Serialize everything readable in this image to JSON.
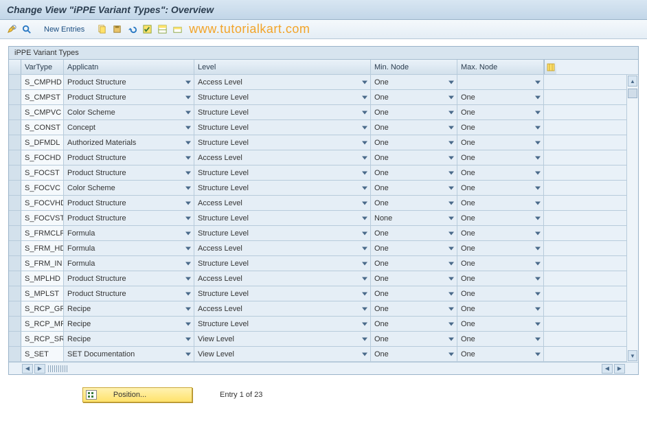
{
  "title": "Change View \"iPPE Variant Types\": Overview",
  "toolbar": {
    "new_entries": "New Entries"
  },
  "watermark": "www.tutorialkart.com",
  "panel": {
    "title": "iPPE Variant Types"
  },
  "columns": {
    "vartype": "VarType",
    "application": "Applicatn",
    "level": "Level",
    "min_node": "Min. Node",
    "max_node": "Max. Node"
  },
  "rows": [
    {
      "vartype": "S_CMPHD",
      "application": "Product Structure",
      "level": "Access Level",
      "min": "One",
      "max": ""
    },
    {
      "vartype": "S_CMPST",
      "application": "Product Structure",
      "level": "Structure Level",
      "min": "One",
      "max": "One"
    },
    {
      "vartype": "S_CMPVC",
      "application": "Color Scheme",
      "level": "Structure Level",
      "min": "One",
      "max": "One"
    },
    {
      "vartype": "S_CONST",
      "application": "Concept",
      "level": "Structure Level",
      "min": "One",
      "max": "One"
    },
    {
      "vartype": "S_DFMDL",
      "application": "Authorized Materials",
      "level": "Structure Level",
      "min": "One",
      "max": "One"
    },
    {
      "vartype": "S_FOCHD",
      "application": "Product Structure",
      "level": "Access Level",
      "min": "One",
      "max": "One"
    },
    {
      "vartype": "S_FOCST",
      "application": "Product Structure",
      "level": "Structure Level",
      "min": "One",
      "max": "One"
    },
    {
      "vartype": "S_FOCVC",
      "application": "Color Scheme",
      "level": "Structure Level",
      "min": "One",
      "max": "One"
    },
    {
      "vartype": "S_FOCVHD",
      "application": "Product Structure",
      "level": "Access Level",
      "min": "One",
      "max": "One"
    },
    {
      "vartype": "S_FOCVST",
      "application": "Product Structure",
      "level": "Structure Level",
      "min": "None",
      "max": "One"
    },
    {
      "vartype": "S_FRMCLF",
      "application": "Formula",
      "level": "Structure Level",
      "min": "One",
      "max": "One"
    },
    {
      "vartype": "S_FRM_HD",
      "application": "Formula",
      "level": "Access Level",
      "min": "One",
      "max": "One"
    },
    {
      "vartype": "S_FRM_IN",
      "application": "Formula",
      "level": "Structure Level",
      "min": "One",
      "max": "One"
    },
    {
      "vartype": "S_MPLHD",
      "application": "Product Structure",
      "level": "Access Level",
      "min": "One",
      "max": "One"
    },
    {
      "vartype": "S_MPLST",
      "application": "Product Structure",
      "level": "Structure Level",
      "min": "One",
      "max": "One"
    },
    {
      "vartype": "S_RCP_GR",
      "application": "Recipe",
      "level": "Access Level",
      "min": "One",
      "max": "One"
    },
    {
      "vartype": "S_RCP_MR",
      "application": "Recipe",
      "level": "Structure Level",
      "min": "One",
      "max": "One"
    },
    {
      "vartype": "S_RCP_SR",
      "application": "Recipe",
      "level": "View Level",
      "min": "One",
      "max": "One"
    },
    {
      "vartype": "S_SET",
      "application": "SET Documentation",
      "level": "View Level",
      "min": "One",
      "max": "One"
    }
  ],
  "footer": {
    "position_label": "Position...",
    "entry_text": "Entry 1 of 23"
  }
}
